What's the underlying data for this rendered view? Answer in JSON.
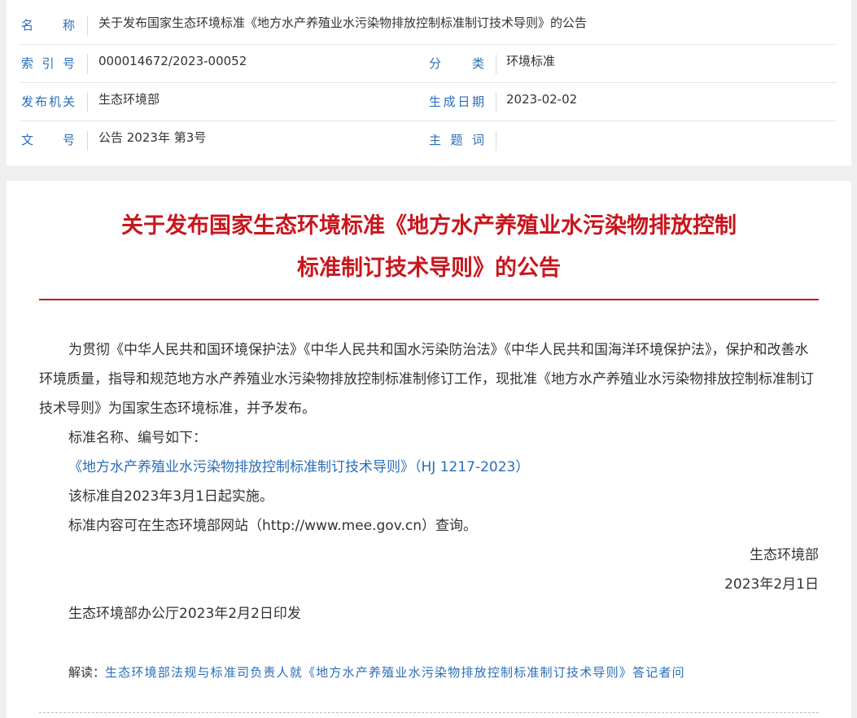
{
  "meta": {
    "name_label": "名　称",
    "name_value": "关于发布国家生态环境标准《地方水产养殖业水污染物排放控制标准制订技术导则》的公告",
    "index_label": "索引号",
    "index_value": "000014672/2023-00052",
    "category_label": "分　类",
    "category_value": "环境标准",
    "issuer_label": "发布机关",
    "issuer_value": "生态环境部",
    "date_label": "生成日期",
    "date_value": "2023-02-02",
    "doc_no_label": "文　号",
    "doc_no_value": "公告 2023年 第3号",
    "keywords_label": "主题词",
    "keywords_value": ""
  },
  "article": {
    "title_line1": "关于发布国家生态环境标准《地方水产养殖业水污染物排放控制",
    "title_line2": "标准制订技术导则》的公告",
    "para1": "为贯彻《中华人民共和国环境保护法》《中华人民共和国水污染防治法》《中华人民共和国海洋环境保护法》，保护和改善水环境质量，指导和规范地方水产养殖业水污染物排放控制标准制修订工作，现批准《地方水产养殖业水污染物排放控制标准制订技术导则》为国家生态环境标准，并予发布。",
    "para2": "标准名称、编号如下：",
    "standard_link": "《地方水产养殖业水污染物排放控制标准制订技术导则》（HJ 1217-2023）",
    "para3": "该标准自2023年3月1日起实施。",
    "para4": "标准内容可在生态环境部网站（http://www.mee.gov.cn）查询。",
    "signature_org": "生态环境部",
    "signature_date": "2023年2月1日",
    "print_note": "生态环境部办公厅2023年2月2日印发",
    "interpretation_label": "解读：",
    "interpretation_link": "生态环境部法规与标准司负责人就《地方水产养殖业水污染物排放控制标准制订技术导则》答记者问"
  },
  "colors": {
    "title_red": "#c8161d",
    "label_blue": "#2a6db8",
    "page_bg": "#efefef"
  }
}
